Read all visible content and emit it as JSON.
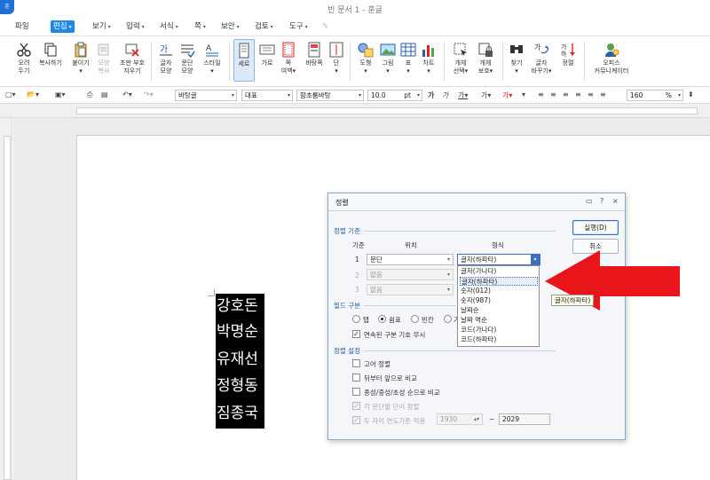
{
  "window": {
    "title": "빈 문서 1 - 훈글",
    "logo": "훈"
  },
  "menu": [
    {
      "label": "파일",
      "arrow": ""
    },
    {
      "label": "편집",
      "arrow": "▾",
      "active": true
    },
    {
      "label": "보기",
      "arrow": "▾"
    },
    {
      "label": "입력",
      "arrow": "▾"
    },
    {
      "label": "서식",
      "arrow": "▾"
    },
    {
      "label": "쪽",
      "arrow": "▾"
    },
    {
      "label": "보안",
      "arrow": "▾"
    },
    {
      "label": "검토",
      "arrow": "▾"
    },
    {
      "label": "도구",
      "arrow": "▾"
    }
  ],
  "ribbon": [
    {
      "l1": "오려",
      "l2": "두기",
      "icon": "scissors-icon"
    },
    {
      "l1": "복사하기",
      "l2": "",
      "icon": "copy-icon"
    },
    {
      "l1": "붙이기",
      "l2": "▾",
      "icon": "paste-icon"
    },
    {
      "l1": "모양",
      "l2": "복사",
      "icon": "format-copy-icon",
      "dim": true
    },
    {
      "l1": "조판 부호",
      "l2": "지우기",
      "icon": "clear-codes-icon"
    },
    {
      "l1": "글자",
      "l2": "모양",
      "icon": "char-shape-icon"
    },
    {
      "l1": "문단",
      "l2": "모양",
      "icon": "para-shape-icon"
    },
    {
      "l1": "스타일",
      "l2": "▾",
      "icon": "style-icon"
    },
    {
      "l1": "세로",
      "l2": "",
      "icon": "vertical-icon",
      "sel": true
    },
    {
      "l1": "가로",
      "l2": "",
      "icon": "horizontal-icon"
    },
    {
      "l1": "쪽",
      "l2": "여백▾",
      "icon": "margin-icon"
    },
    {
      "l1": "바탕쪽",
      "l2": "",
      "icon": "master-page-icon"
    },
    {
      "l1": "단",
      "l2": "▾",
      "icon": "column-icon"
    },
    {
      "l1": "도형",
      "l2": "▾",
      "icon": "shape-icon"
    },
    {
      "l1": "그림",
      "l2": "▾",
      "icon": "picture-icon"
    },
    {
      "l1": "표",
      "l2": "▾",
      "icon": "table-icon"
    },
    {
      "l1": "차트",
      "l2": "▾",
      "icon": "chart-icon"
    },
    {
      "l1": "개체",
      "l2": "선택▾",
      "icon": "object-select-icon"
    },
    {
      "l1": "개체",
      "l2": "보호▾",
      "icon": "object-lock-icon"
    },
    {
      "l1": "찾기",
      "l2": "▾",
      "icon": "find-icon"
    },
    {
      "l1": "글자",
      "l2": "바꾸기▾",
      "icon": "replace-icon"
    },
    {
      "l1": "정렬",
      "l2": "",
      "icon": "sort-icon"
    },
    {
      "l1": "오피스",
      "l2": "커뮤니케이터",
      "icon": "office-communicator-icon"
    }
  ],
  "formatbar": {
    "style": "바탕글",
    "lang": "대표",
    "font": "함초롬바탕",
    "size": "10.0",
    "unit": "pt",
    "zoom": "160",
    "zoom_unit": "%"
  },
  "document": {
    "lines": [
      "강호돈",
      "박명순",
      "유재선",
      "정형동",
      "짐종국"
    ]
  },
  "dialog": {
    "title": "정렬",
    "help": "?",
    "close": "×",
    "run_button": "실행(D)",
    "cancel_button": "취소",
    "criteria_group": "정렬 기준",
    "col_key": "기준",
    "col_position": "위치",
    "col_format": "형식",
    "rows": [
      {
        "num": "1",
        "position": "문단",
        "format": "글자(하파타)",
        "enabled": true
      },
      {
        "num": "2",
        "position": "없음",
        "format": "글자(가나다)",
        "enabled": false
      },
      {
        "num": "3",
        "position": "없음",
        "format": "글자(가나다)",
        "enabled": false
      }
    ],
    "dropdown_options": [
      "글자(가나다)",
      "글자(하파타)",
      "숫자(012)",
      "숫자(987)",
      "날짜순",
      "날짜 역순",
      "코드(가나다)",
      "코드(하파타)"
    ],
    "dropdown_selected_index": 1,
    "tooltip": "글자(하파타)",
    "field_group": "필드 구분",
    "field_options": [
      "탭",
      "쉼표",
      "빈칸",
      "기"
    ],
    "field_selected_index": 1,
    "ignore_consecutive": "연속된 구분 기호 무시",
    "settings_group": "정렬 설정",
    "setting_items": [
      {
        "label": "고어 정렬",
        "checked": false,
        "enabled": true
      },
      {
        "label": "뒤부터 앞으로 비교",
        "checked": false,
        "enabled": true
      },
      {
        "label": "종성/중성/초성 순으로 비교",
        "checked": false,
        "enabled": true
      },
      {
        "label": "각 문단별 단어 정렬",
        "checked": true,
        "enabled": false
      },
      {
        "label": "두 자리 연도기준 적용",
        "checked": true,
        "enabled": false
      }
    ],
    "year_from": "1930",
    "year_tilde": "~",
    "year_to": "2029"
  },
  "colors": {
    "accent": "#1e88e5",
    "highlight_arrow": "#e8161b",
    "selection": "#000000"
  }
}
